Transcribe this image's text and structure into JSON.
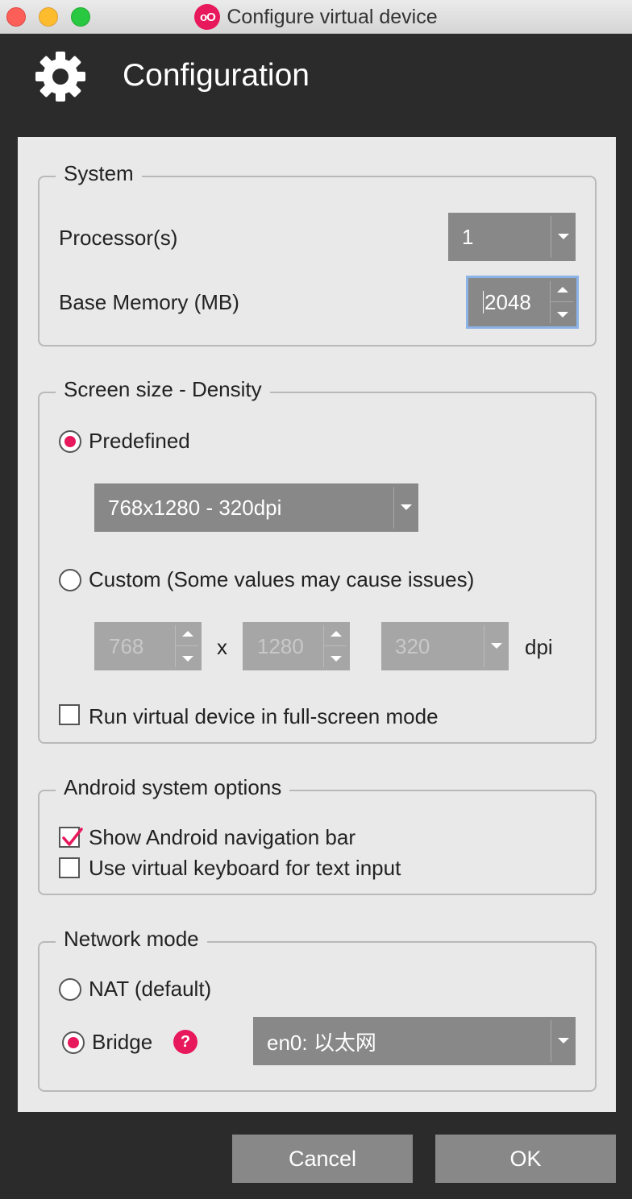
{
  "window": {
    "title": "Configure virtual device",
    "logo_text": "oO"
  },
  "header": {
    "title": "Configuration"
  },
  "system": {
    "legend": "System",
    "processors_label": "Processor(s)",
    "processors_value": "1",
    "memory_label": "Base Memory (MB)",
    "memory_value": "2048"
  },
  "screen": {
    "legend": "Screen size - Density",
    "predefined_label": "Predefined",
    "predefined_selected": true,
    "predefined_value": "768x1280 - 320dpi",
    "custom_label": "Custom (Some values may cause issues)",
    "custom_selected": false,
    "width_value": "768",
    "times_label": "x",
    "height_value": "1280",
    "dpi_value": "320",
    "dpi_label": "dpi",
    "fullscreen_label": "Run virtual device in full-screen mode",
    "fullscreen_checked": false
  },
  "android": {
    "legend": "Android system options",
    "navbar_label": "Show Android navigation bar",
    "navbar_checked": true,
    "keyboard_label": "Use virtual keyboard for text input",
    "keyboard_checked": false
  },
  "network": {
    "legend": "Network mode",
    "nat_label": "NAT (default)",
    "nat_selected": false,
    "bridge_label": "Bridge",
    "bridge_selected": true,
    "help_glyph": "?",
    "interface_value": "en0: 以太网"
  },
  "buttons": {
    "cancel_label": "Cancel",
    "ok_label": "OK"
  },
  "colors": {
    "accent": "#e8185c",
    "control": "#888888",
    "panel": "#e9e9e9",
    "chrome": "#2b2b2b"
  },
  "icons": {
    "header": "gear-icon",
    "help": "help-icon"
  }
}
